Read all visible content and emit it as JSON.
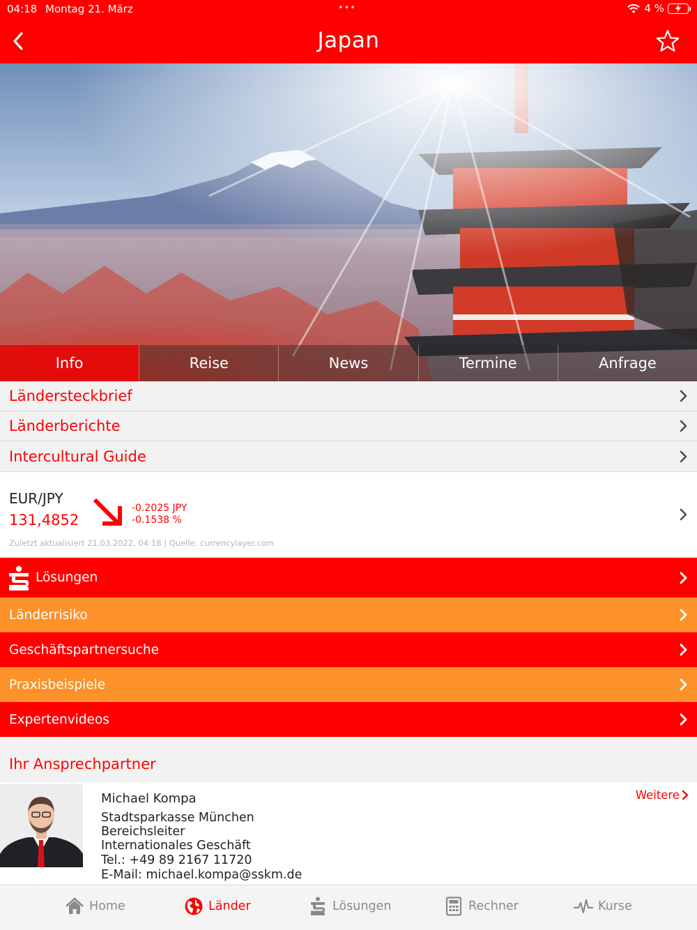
{
  "status_bar": {
    "time": "04:18",
    "date": "Montag 21. März",
    "dots": "•••",
    "battery_percent": "4 %"
  },
  "nav": {
    "title": "Japan",
    "back_icon": "chevron-left-icon",
    "favorite_icon": "star-outline-icon"
  },
  "hero": {
    "tabs": [
      {
        "label": "Info",
        "active": true
      },
      {
        "label": "Reise",
        "active": false
      },
      {
        "label": "News",
        "active": false
      },
      {
        "label": "Termine",
        "active": false
      },
      {
        "label": "Anfrage",
        "active": false
      }
    ]
  },
  "links": [
    {
      "label": "Ländersteckbrief"
    },
    {
      "label": "Länderberichte"
    },
    {
      "label": "Intercultural Guide"
    }
  ],
  "currency": {
    "pair": "EUR/JPY",
    "rate": "131,4852",
    "change_abs": "-0.2025 JPY",
    "change_pct": "-0.1538 %",
    "trend_icon": "arrow-down-right-icon",
    "updated": "Zuletzt aktualisiert  21.03.2022, 04:18 | Quelle: currencylayer.com"
  },
  "menu": [
    {
      "label": "Lösungen",
      "color": "#ff0000"
    },
    {
      "label": "Länderrisiko",
      "color": "#fd922b"
    },
    {
      "label": "Geschäftspartnersuche",
      "color": "#ff0000"
    },
    {
      "label": "Praxisbeispiele",
      "color": "#fd922b"
    },
    {
      "label": "Expertenvideos",
      "color": "#ff0000"
    }
  ],
  "contact": {
    "heading": "Ihr Ansprechpartner",
    "name": "Michael Kompa",
    "org": "Stadtsparkasse München",
    "role": "Bereichsleiter",
    "department": "Internationales Geschäft",
    "phone": "Tel.: +49 89 2167 11720",
    "email": "E-Mail: michael.kompa@sskm.de",
    "more_label": "Weitere"
  },
  "tabbar": [
    {
      "label": "Home",
      "icon": "house-icon",
      "active": false
    },
    {
      "label": "Länder",
      "icon": "globe-icon",
      "active": true
    },
    {
      "label": "Lösungen",
      "icon": "sparkasse-icon",
      "active": false
    },
    {
      "label": "Rechner",
      "icon": "calculator-icon",
      "active": false
    },
    {
      "label": "Kurse",
      "icon": "pulse-chart-icon",
      "active": false
    }
  ],
  "colors": {
    "brand_red": "#ff0000",
    "accent_orange": "#fd922b",
    "list_background": "#f2f2f2"
  }
}
